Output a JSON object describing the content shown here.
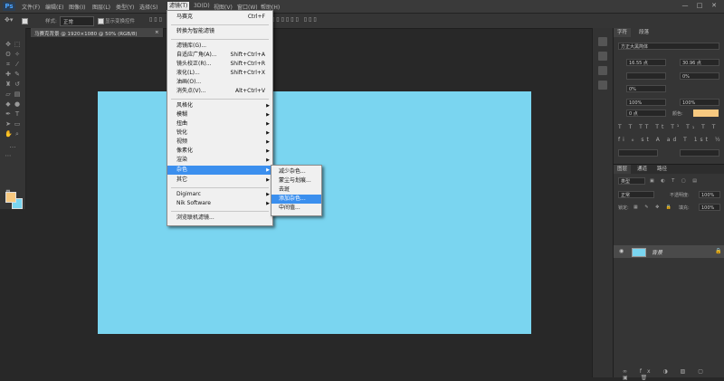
{
  "menubar": {
    "logo": "Ps",
    "items": [
      "文件(F)",
      "编辑(E)",
      "图像(I)",
      "图层(L)",
      "类型(Y)",
      "选择(S)",
      "滤镜(T)",
      "3D(D)",
      "视图(V)",
      "窗口(W)",
      "帮助(H)"
    ],
    "active_index": 6,
    "window_controls": [
      "—",
      "□",
      "✕"
    ]
  },
  "options_bar": {
    "sample_label": "样式:",
    "mode_value": "正常",
    "checkbox_label": "显示变换控件"
  },
  "document_tab": {
    "title": "马赛克背景 @ 1920×1080 @ 50% (RGB/8)",
    "close": "×"
  },
  "colors": {
    "canvas_fill": "#7ad5f0",
    "foreground": "#f7c980",
    "background_swatch": "#7ad5f0",
    "menu_highlight": "#3b8fee"
  },
  "filter_menu": {
    "items": [
      {
        "label": "马赛克",
        "shortcut": "Ctrl+F"
      },
      {
        "label": "转换为智能滤镜"
      },
      {
        "label": "滤镜库(G)..."
      },
      {
        "label": "自适应广角(A)...",
        "shortcut": "Shift+Ctrl+A"
      },
      {
        "label": "镜头校正(R)...",
        "shortcut": "Shift+Ctrl+R"
      },
      {
        "label": "液化(L)...",
        "shortcut": "Shift+Ctrl+X"
      },
      {
        "label": "油画(O)..."
      },
      {
        "label": "消失点(V)...",
        "shortcut": "Alt+Ctrl+V"
      },
      {
        "label": "风格化",
        "submenu": true
      },
      {
        "label": "模糊",
        "submenu": true
      },
      {
        "label": "扭曲",
        "submenu": true
      },
      {
        "label": "锐化",
        "submenu": true
      },
      {
        "label": "视频",
        "submenu": true
      },
      {
        "label": "像素化",
        "submenu": true
      },
      {
        "label": "渲染",
        "submenu": true
      },
      {
        "label": "杂色",
        "submenu": true,
        "highlighted": true
      },
      {
        "label": "其它",
        "submenu": true
      },
      {
        "label": "Digimarc",
        "submenu": true
      },
      {
        "label": "Nik Software",
        "submenu": true
      },
      {
        "label": "浏览联机滤镜..."
      }
    ]
  },
  "noise_submenu": {
    "items": [
      {
        "label": "减少杂色..."
      },
      {
        "label": "蒙尘与划痕..."
      },
      {
        "label": "去斑"
      },
      {
        "label": "添加杂色...",
        "highlighted": true
      },
      {
        "label": "中间值..."
      }
    ]
  },
  "right_panel": {
    "char_tabs": [
      "字符",
      "段落"
    ],
    "font_family": "方正大黑简体",
    "font_size": "16.55 点",
    "leading": "30.96 点",
    "tracking": "0%",
    "scale_v": "100%",
    "scale_h": "100%",
    "baseline": "0 点",
    "color_label": "颜色:",
    "layers_tabs": [
      "图层",
      "通道",
      "路径"
    ],
    "blend_mode": "正常",
    "opacity_label": "不透明度:",
    "opacity": "100%",
    "fill_label": "填充:",
    "fill": "100%",
    "lock_label": "锁定:",
    "layer_name": "背景",
    "kind_label": "类型"
  }
}
